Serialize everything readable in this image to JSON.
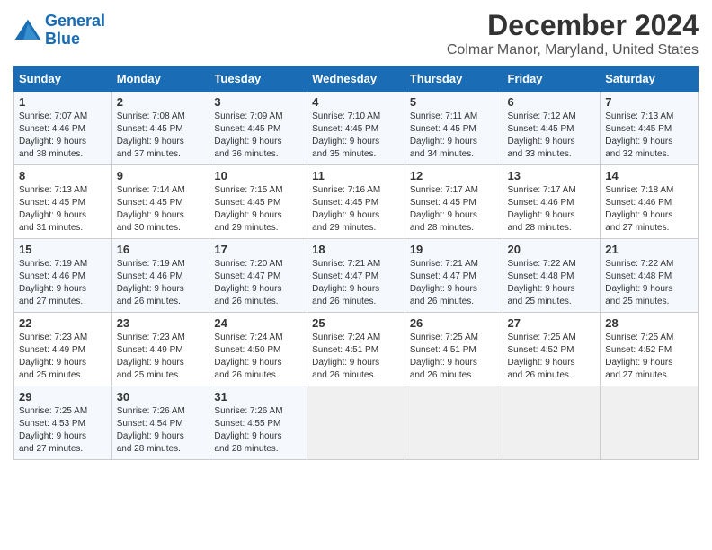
{
  "logo": {
    "line1": "General",
    "line2": "Blue"
  },
  "title": "December 2024",
  "subtitle": "Colmar Manor, Maryland, United States",
  "days_of_week": [
    "Sunday",
    "Monday",
    "Tuesday",
    "Wednesday",
    "Thursday",
    "Friday",
    "Saturday"
  ],
  "weeks": [
    [
      {
        "day": "1",
        "detail": "Sunrise: 7:07 AM\nSunset: 4:46 PM\nDaylight: 9 hours\nand 38 minutes."
      },
      {
        "day": "2",
        "detail": "Sunrise: 7:08 AM\nSunset: 4:45 PM\nDaylight: 9 hours\nand 37 minutes."
      },
      {
        "day": "3",
        "detail": "Sunrise: 7:09 AM\nSunset: 4:45 PM\nDaylight: 9 hours\nand 36 minutes."
      },
      {
        "day": "4",
        "detail": "Sunrise: 7:10 AM\nSunset: 4:45 PM\nDaylight: 9 hours\nand 35 minutes."
      },
      {
        "day": "5",
        "detail": "Sunrise: 7:11 AM\nSunset: 4:45 PM\nDaylight: 9 hours\nand 34 minutes."
      },
      {
        "day": "6",
        "detail": "Sunrise: 7:12 AM\nSunset: 4:45 PM\nDaylight: 9 hours\nand 33 minutes."
      },
      {
        "day": "7",
        "detail": "Sunrise: 7:13 AM\nSunset: 4:45 PM\nDaylight: 9 hours\nand 32 minutes."
      }
    ],
    [
      {
        "day": "8",
        "detail": "Sunrise: 7:13 AM\nSunset: 4:45 PM\nDaylight: 9 hours\nand 31 minutes."
      },
      {
        "day": "9",
        "detail": "Sunrise: 7:14 AM\nSunset: 4:45 PM\nDaylight: 9 hours\nand 30 minutes."
      },
      {
        "day": "10",
        "detail": "Sunrise: 7:15 AM\nSunset: 4:45 PM\nDaylight: 9 hours\nand 29 minutes."
      },
      {
        "day": "11",
        "detail": "Sunrise: 7:16 AM\nSunset: 4:45 PM\nDaylight: 9 hours\nand 29 minutes."
      },
      {
        "day": "12",
        "detail": "Sunrise: 7:17 AM\nSunset: 4:45 PM\nDaylight: 9 hours\nand 28 minutes."
      },
      {
        "day": "13",
        "detail": "Sunrise: 7:17 AM\nSunset: 4:46 PM\nDaylight: 9 hours\nand 28 minutes."
      },
      {
        "day": "14",
        "detail": "Sunrise: 7:18 AM\nSunset: 4:46 PM\nDaylight: 9 hours\nand 27 minutes."
      }
    ],
    [
      {
        "day": "15",
        "detail": "Sunrise: 7:19 AM\nSunset: 4:46 PM\nDaylight: 9 hours\nand 27 minutes."
      },
      {
        "day": "16",
        "detail": "Sunrise: 7:19 AM\nSunset: 4:46 PM\nDaylight: 9 hours\nand 26 minutes."
      },
      {
        "day": "17",
        "detail": "Sunrise: 7:20 AM\nSunset: 4:47 PM\nDaylight: 9 hours\nand 26 minutes."
      },
      {
        "day": "18",
        "detail": "Sunrise: 7:21 AM\nSunset: 4:47 PM\nDaylight: 9 hours\nand 26 minutes."
      },
      {
        "day": "19",
        "detail": "Sunrise: 7:21 AM\nSunset: 4:47 PM\nDaylight: 9 hours\nand 26 minutes."
      },
      {
        "day": "20",
        "detail": "Sunrise: 7:22 AM\nSunset: 4:48 PM\nDaylight: 9 hours\nand 25 minutes."
      },
      {
        "day": "21",
        "detail": "Sunrise: 7:22 AM\nSunset: 4:48 PM\nDaylight: 9 hours\nand 25 minutes."
      }
    ],
    [
      {
        "day": "22",
        "detail": "Sunrise: 7:23 AM\nSunset: 4:49 PM\nDaylight: 9 hours\nand 25 minutes."
      },
      {
        "day": "23",
        "detail": "Sunrise: 7:23 AM\nSunset: 4:49 PM\nDaylight: 9 hours\nand 25 minutes."
      },
      {
        "day": "24",
        "detail": "Sunrise: 7:24 AM\nSunset: 4:50 PM\nDaylight: 9 hours\nand 26 minutes."
      },
      {
        "day": "25",
        "detail": "Sunrise: 7:24 AM\nSunset: 4:51 PM\nDaylight: 9 hours\nand 26 minutes."
      },
      {
        "day": "26",
        "detail": "Sunrise: 7:25 AM\nSunset: 4:51 PM\nDaylight: 9 hours\nand 26 minutes."
      },
      {
        "day": "27",
        "detail": "Sunrise: 7:25 AM\nSunset: 4:52 PM\nDaylight: 9 hours\nand 26 minutes."
      },
      {
        "day": "28",
        "detail": "Sunrise: 7:25 AM\nSunset: 4:52 PM\nDaylight: 9 hours\nand 27 minutes."
      }
    ],
    [
      {
        "day": "29",
        "detail": "Sunrise: 7:25 AM\nSunset: 4:53 PM\nDaylight: 9 hours\nand 27 minutes."
      },
      {
        "day": "30",
        "detail": "Sunrise: 7:26 AM\nSunset: 4:54 PM\nDaylight: 9 hours\nand 28 minutes."
      },
      {
        "day": "31",
        "detail": "Sunrise: 7:26 AM\nSunset: 4:55 PM\nDaylight: 9 hours\nand 28 minutes."
      },
      {
        "day": "",
        "detail": ""
      },
      {
        "day": "",
        "detail": ""
      },
      {
        "day": "",
        "detail": ""
      },
      {
        "day": "",
        "detail": ""
      }
    ]
  ],
  "colors": {
    "header_bg": "#1a6db5",
    "odd_row": "#f5f8fd",
    "even_row": "#ffffff",
    "empty_cell": "#f0f0f0"
  }
}
